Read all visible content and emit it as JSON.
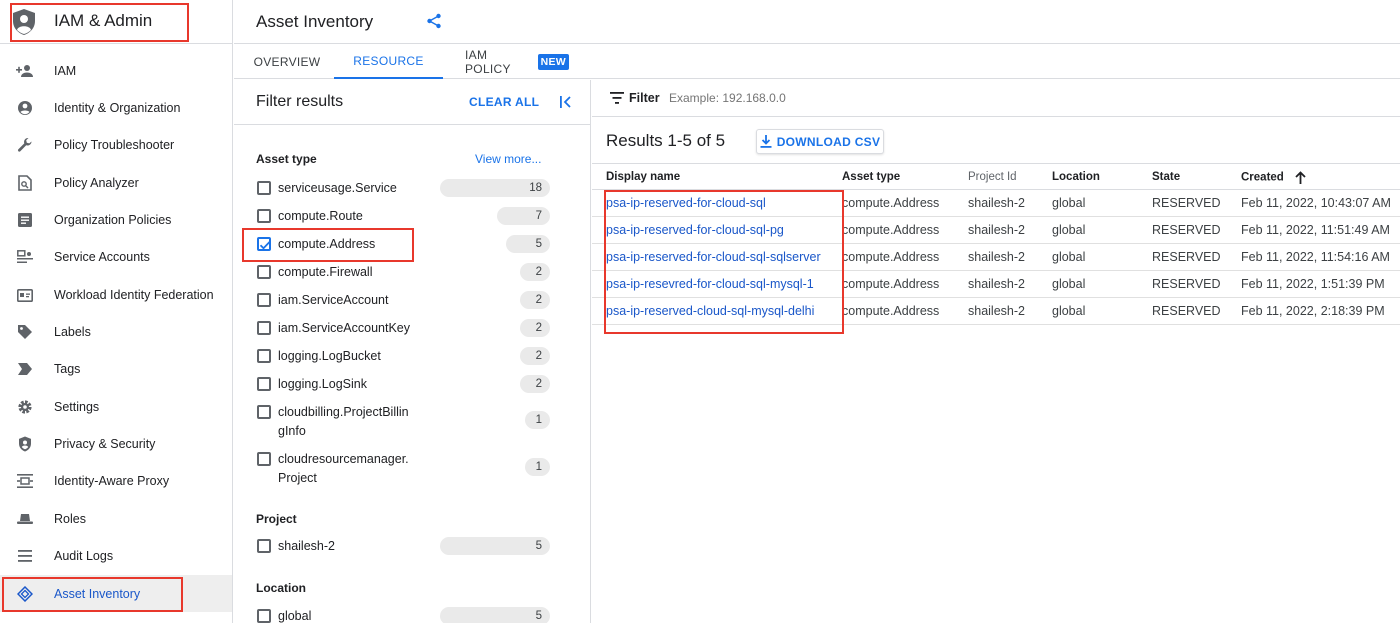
{
  "app": {
    "title": "IAM & Admin"
  },
  "sidebar": {
    "items": [
      {
        "label": "IAM",
        "icon": "person-add-icon"
      },
      {
        "label": "Identity & Organization",
        "icon": "account-circle-icon"
      },
      {
        "label": "Policy Troubleshooter",
        "icon": "wrench-icon"
      },
      {
        "label": "Policy Analyzer",
        "icon": "document-search-icon"
      },
      {
        "label": "Organization Policies",
        "icon": "list-box-icon"
      },
      {
        "label": "Service Accounts",
        "icon": "service-account-icon"
      },
      {
        "label": "Workload Identity Federation",
        "icon": "id-card-icon"
      },
      {
        "label": "Labels",
        "icon": "label-icon"
      },
      {
        "label": "Tags",
        "icon": "tag-arrow-icon"
      },
      {
        "label": "Settings",
        "icon": "gear-icon"
      },
      {
        "label": "Privacy & Security",
        "icon": "shield-icon"
      },
      {
        "label": "Identity-Aware Proxy",
        "icon": "proxy-icon"
      },
      {
        "label": "Roles",
        "icon": "hat-icon"
      },
      {
        "label": "Audit Logs",
        "icon": "lines-icon"
      },
      {
        "label": "Asset Inventory",
        "icon": "diamond-icon"
      }
    ]
  },
  "header": {
    "title": "Asset Inventory"
  },
  "tabs": [
    {
      "label": "OVERVIEW"
    },
    {
      "label": "RESOURCE"
    },
    {
      "label": "IAM POLICY",
      "badge": "NEW"
    }
  ],
  "filters": {
    "title": "Filter results",
    "clear_all": "CLEAR ALL",
    "asset_type": {
      "title": "Asset type",
      "view_more": "View more...",
      "items": [
        {
          "label": "serviceusage.Service",
          "count": "18",
          "checked": false
        },
        {
          "label": "compute.Route",
          "count": "7",
          "checked": false
        },
        {
          "label": "compute.Address",
          "count": "5",
          "checked": true
        },
        {
          "label": "compute.Firewall",
          "count": "2",
          "checked": false
        },
        {
          "label": "iam.ServiceAccount",
          "count": "2",
          "checked": false
        },
        {
          "label": "iam.ServiceAccountKey",
          "count": "2",
          "checked": false
        },
        {
          "label": "logging.LogBucket",
          "count": "2",
          "checked": false
        },
        {
          "label": "logging.LogSink",
          "count": "2",
          "checked": false
        },
        {
          "label": "cloudbilling.ProjectBillingInfo",
          "count": "1",
          "checked": false
        },
        {
          "label": "cloudresourcemanager.Project",
          "count": "1",
          "checked": false
        }
      ]
    },
    "project": {
      "title": "Project",
      "items": [
        {
          "label": "shailesh-2",
          "count": "5"
        }
      ]
    },
    "location": {
      "title": "Location",
      "items": [
        {
          "label": "global",
          "count": "5"
        }
      ]
    }
  },
  "results": {
    "filter_label": "Filter",
    "filter_placeholder": "Example: 192.168.0.0",
    "count_text": "Results 1-5 of 5",
    "download_label": "DOWNLOAD CSV",
    "columns": [
      "Display name",
      "Asset type",
      "Project Id",
      "Location",
      "State",
      "Created"
    ],
    "rows": [
      [
        "psa-ip-reserved-for-cloud-sql",
        "compute.Address",
        "shailesh-2",
        "global",
        "RESERVED",
        "Feb 11, 2022, 10:43:07 AM"
      ],
      [
        "psa-ip-reserved-for-cloud-sql-pg",
        "compute.Address",
        "shailesh-2",
        "global",
        "RESERVED",
        "Feb 11, 2022, 11:51:49 AM"
      ],
      [
        "psa-ip-reserved-for-cloud-sql-sqlserver",
        "compute.Address",
        "shailesh-2",
        "global",
        "RESERVED",
        "Feb 11, 2022, 11:54:16 AM"
      ],
      [
        "psa-ip-resevred-for-cloud-sql-mysql-1",
        "compute.Address",
        "shailesh-2",
        "global",
        "RESERVED",
        "Feb 11, 2022, 1:51:39 PM"
      ],
      [
        "psa-ip-reserved-cloud-sql-mysql-delhi",
        "compute.Address",
        "shailesh-2",
        "global",
        "RESERVED",
        "Feb 11, 2022, 2:18:39 PM"
      ]
    ]
  },
  "colors": {
    "accent": "#1a73e8",
    "link": "#1a57c9",
    "annotation": "#e8382c"
  }
}
